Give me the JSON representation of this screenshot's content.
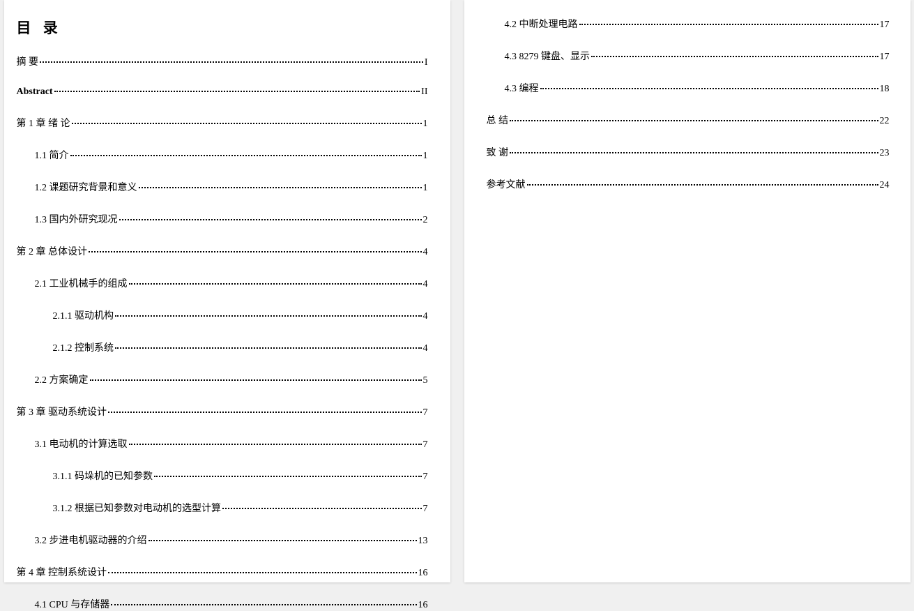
{
  "title": "目 录",
  "left": [
    {
      "label": "摘  要",
      "page": "I",
      "level": 1
    },
    {
      "label": "Abstract",
      "page": "II",
      "level": 1,
      "bold": true
    },
    {
      "label": "第 1 章  绪  论",
      "page": "1",
      "level": 1
    },
    {
      "label": "1.1 简介",
      "page": "1",
      "level": 2
    },
    {
      "label": "1.2 课题研究背景和意义",
      "page": "1",
      "level": 2
    },
    {
      "label": "1.3 国内外研究现况",
      "page": "2",
      "level": 2
    },
    {
      "label": "第 2 章  总体设计",
      "page": "4",
      "level": 1
    },
    {
      "label": "2.1 工业机械手的组成",
      "page": "4",
      "level": 2
    },
    {
      "label": "2.1.1 驱动机构",
      "page": "4",
      "level": 3
    },
    {
      "label": "2.1.2 控制系统",
      "page": "4",
      "level": 3
    },
    {
      "label": "2.2 方案确定",
      "page": "5",
      "level": 2
    },
    {
      "label": "第 3 章  驱动系统设计",
      "page": "7",
      "level": 1
    },
    {
      "label": "3.1 电动机的计算选取",
      "page": "7",
      "level": 2
    },
    {
      "label": "3.1.1 码垛机的已知参数",
      "page": "7",
      "level": 3
    },
    {
      "label": "3.1.2 根据已知参数对电动机的选型计算",
      "page": "7",
      "level": 3
    },
    {
      "label": "3.2 步进电机驱动器的介绍",
      "page": "13",
      "level": 2
    },
    {
      "label": "第 4 章  控制系统设计",
      "page": "16",
      "level": 1
    },
    {
      "label": "4.1 CPU 与存储器",
      "page": "16",
      "level": 2
    }
  ],
  "right": [
    {
      "label": "4.2 中断处理电路",
      "page": "17",
      "level": 2
    },
    {
      "label": "4.3 8279 键盘、显示",
      "page": "17",
      "level": 2
    },
    {
      "label": "4.3 编程",
      "page": "18",
      "level": 2
    },
    {
      "label": "总  结",
      "page": "22",
      "level": 1
    },
    {
      "label": "致    谢",
      "page": "23",
      "level": 1
    },
    {
      "label": "参考文献",
      "page": "24",
      "level": 1
    }
  ]
}
